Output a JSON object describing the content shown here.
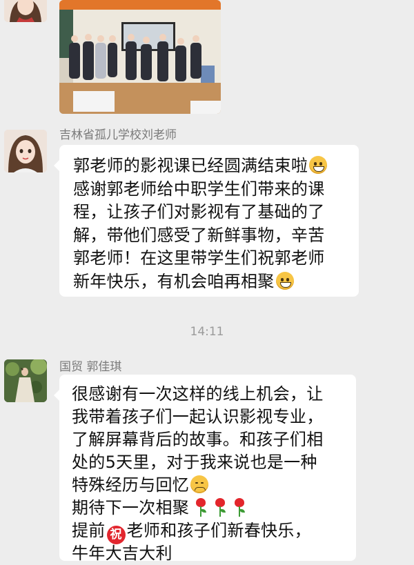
{
  "messages": [
    {
      "type": "image",
      "description_icon": "photo-students-classroom"
    },
    {
      "sender": "吉林省孤儿学校刘老师",
      "lines": [
        "郭老师的影视课已经圆满结束啦",
        "感谢郭老师给中职学生们带来的课",
        "程，让孩子们对影视有了基础的了",
        "解，带他们感受了新鲜事物，辛苦",
        "郭老师！在这里带学生们祝郭老师",
        "新年快乐，有机会咱再相聚"
      ]
    },
    {
      "sender": "国贸  郭佳琪",
      "lines": [
        "很感谢有一次这样的线上机会，让",
        "我带着孩子们一起认识影视专业，",
        "了解屏幕背后的故事。和孩子们相",
        "处的5天里，对于我来说也是一种",
        "特殊经历与回忆",
        "期待下一次相聚",
        "老师和孩子们新春快乐，",
        "牛年大吉大利"
      ],
      "line7_prefix": "提前",
      "zhu_glyph": "祝"
    }
  ],
  "timestamp": "14:11",
  "icons": {
    "emoji_smile": "grinning-face-icon",
    "emoji_sad": "sad-face-icon",
    "rose": "rose-icon",
    "zhu": "zhu-blessing-icon"
  }
}
